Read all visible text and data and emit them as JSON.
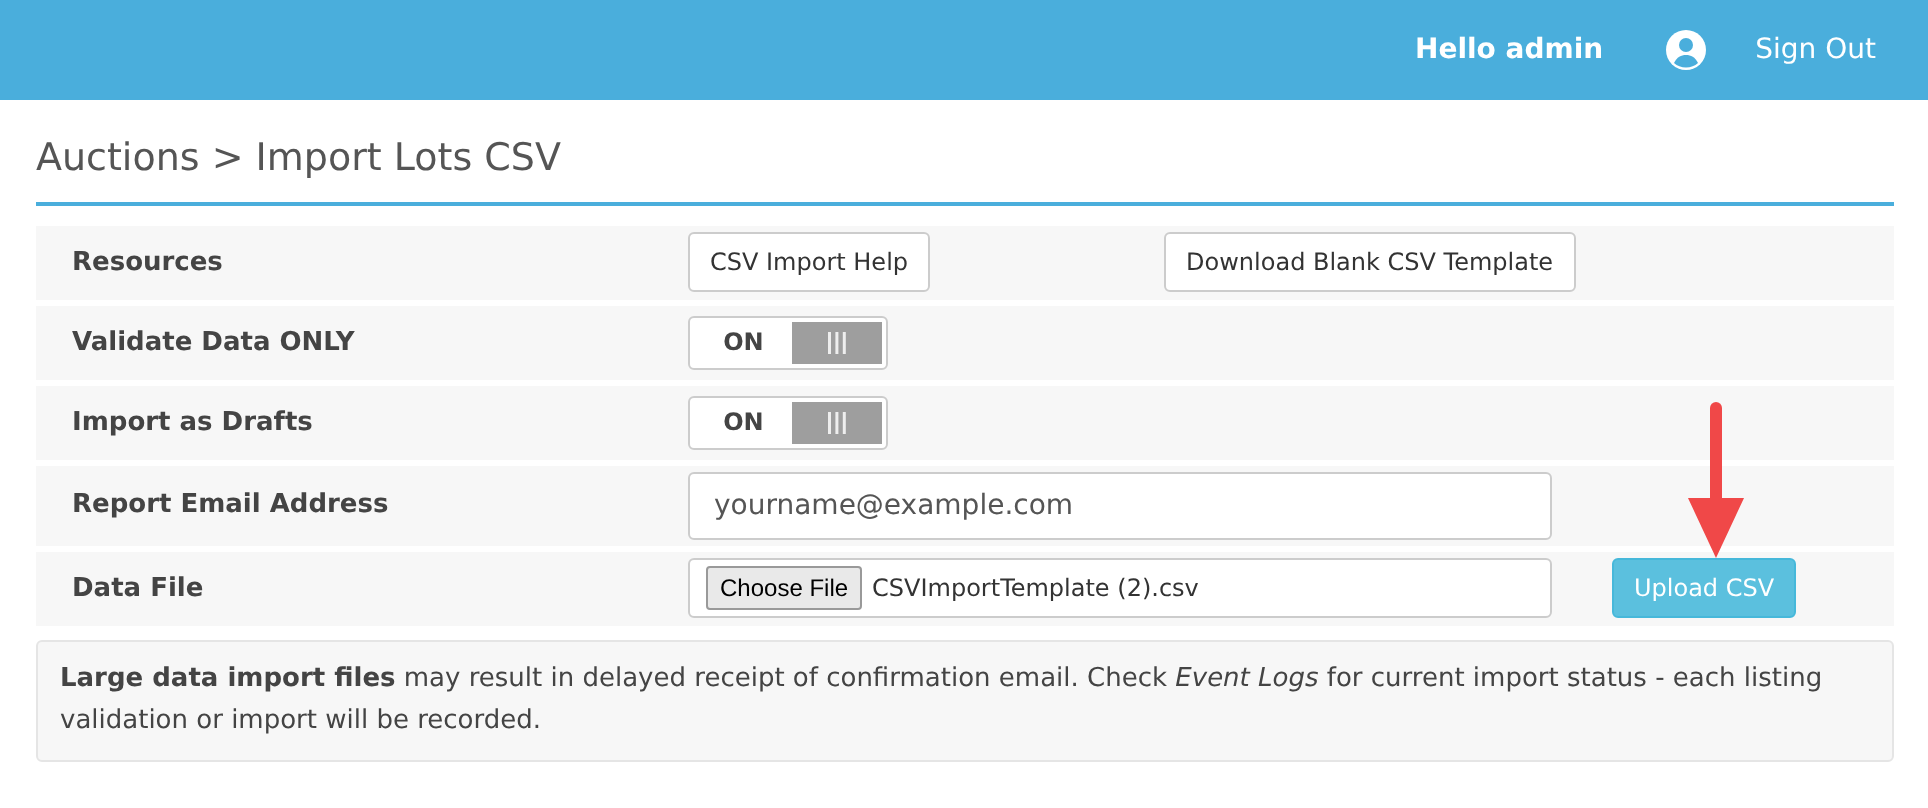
{
  "header": {
    "greeting": "Hello admin",
    "sign_out": "Sign Out"
  },
  "title": "Auctions > Import Lots CSV",
  "rows": [
    {
      "kind": "buttons",
      "label": "Resources",
      "buttons": [
        "CSV Import Help",
        "Download Blank CSV Template"
      ]
    },
    {
      "kind": "toggle",
      "label": "Validate Data ONLY",
      "text": "ON",
      "on": true
    },
    {
      "kind": "toggle",
      "label": "Import as Drafts",
      "text": "ON",
      "on": true
    },
    {
      "kind": "email",
      "label": "Report Email Address",
      "placeholder": "yourname@example.com"
    },
    {
      "kind": "file",
      "label": "Data File",
      "choose": "Choose File",
      "filename": "CSVImportTemplate (2).csv",
      "upload": "Upload CSV"
    }
  ],
  "note": "**Large data import files** may result in delayed receipt of confirmation email. Check *Event Logs* for current import status - each listing validation or import will be recorded."
}
